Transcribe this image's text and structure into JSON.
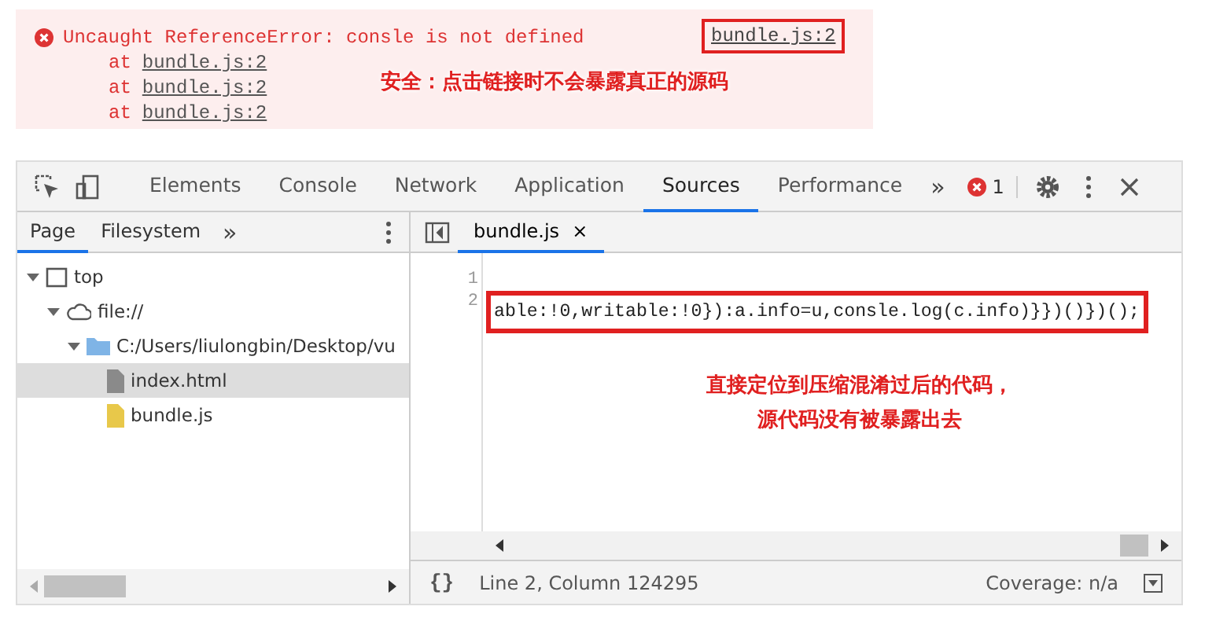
{
  "console": {
    "error": {
      "message": "Uncaught ReferenceError: consle is not defined",
      "source": "bundle.js:2"
    },
    "stack": [
      {
        "prefix": "at",
        "link": "bundle.js:2"
      },
      {
        "prefix": "at",
        "link": "bundle.js:2"
      },
      {
        "prefix": "at",
        "link": "bundle.js:2"
      }
    ],
    "note": "安全：点击链接时不会暴露真正的源码"
  },
  "devtools": {
    "tabs": [
      {
        "label": "Elements",
        "selected": false
      },
      {
        "label": "Console",
        "selected": false
      },
      {
        "label": "Network",
        "selected": false
      },
      {
        "label": "Application",
        "selected": false
      },
      {
        "label": "Sources",
        "selected": true
      },
      {
        "label": "Performance",
        "selected": false
      }
    ],
    "more": "»",
    "error_count": "1",
    "navigator": {
      "tabs": [
        {
          "label": "Page",
          "selected": true
        },
        {
          "label": "Filesystem",
          "selected": false
        }
      ],
      "more": "»",
      "tree": [
        {
          "kind": "frame",
          "label": "top",
          "expanded": true,
          "children": [
            {
              "kind": "origin",
              "label": "file://",
              "expanded": true,
              "children": [
                {
                  "kind": "folder",
                  "label": "C:/Users/liulongbin/Desktop/vu",
                  "expanded": true,
                  "children": [
                    {
                      "kind": "file",
                      "label": "index.html",
                      "selected": true,
                      "color": "#8a8a8a"
                    },
                    {
                      "kind": "file",
                      "label": "bundle.js",
                      "selected": false,
                      "color": "#e8c84a"
                    }
                  ]
                }
              ]
            }
          ]
        }
      ]
    },
    "editor": {
      "file_tab": {
        "label": "bundle.js",
        "close": "×"
      },
      "line_numbers": [
        "1",
        "2"
      ],
      "code": "able:!0,writable:!0}):a.info=u,consle.log(c.info)}})()})();",
      "note": [
        "直接定位到压缩混淆过后的代码，",
        "源代码没有被暴露出去"
      ],
      "status": {
        "format": "{}",
        "position": "Line 2, Column 124295",
        "coverage": "Coverage: n/a"
      }
    }
  }
}
